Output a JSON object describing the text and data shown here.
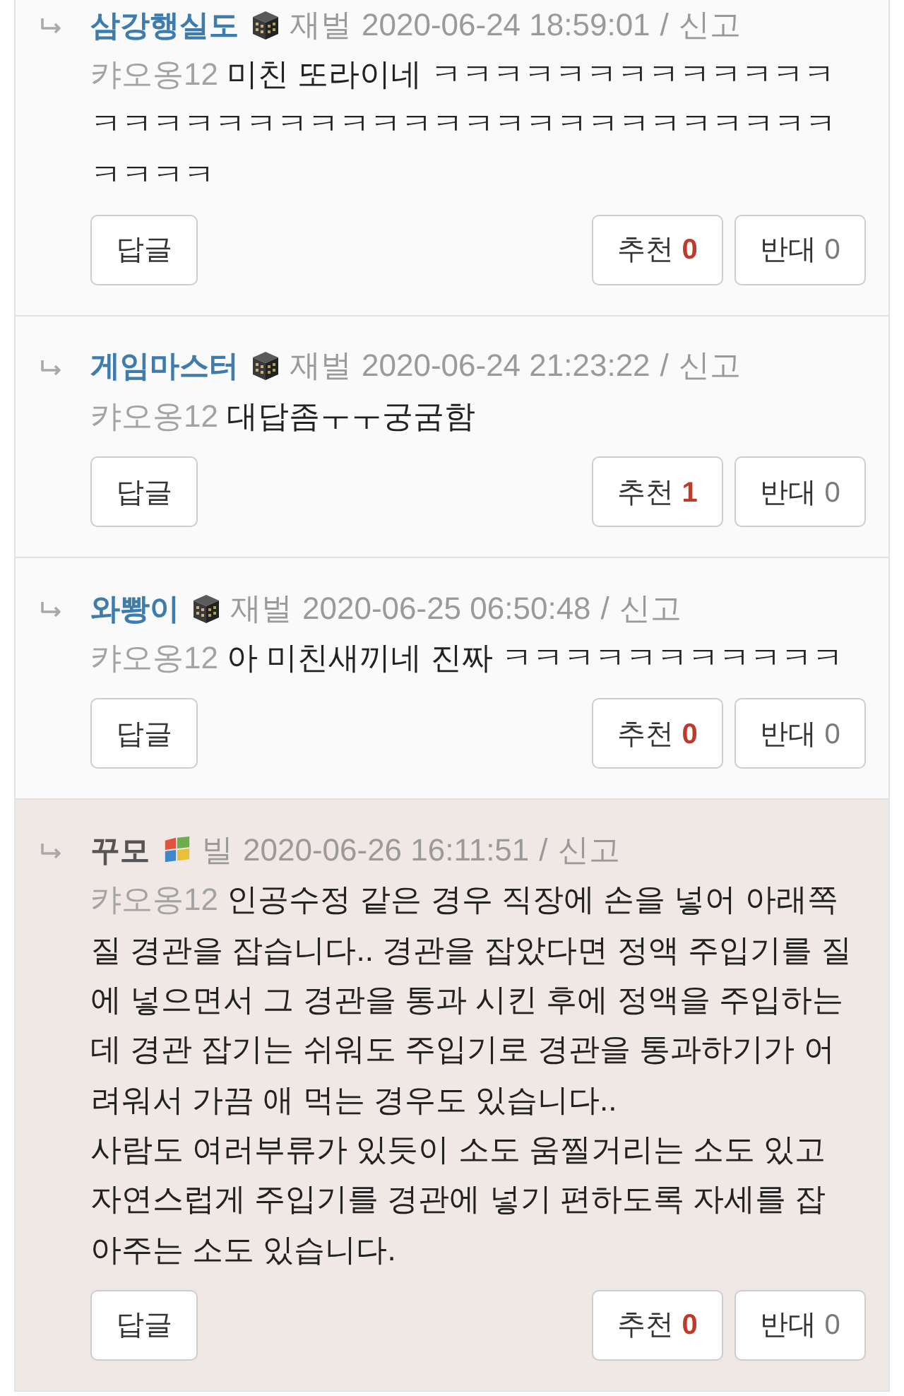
{
  "comments": [
    {
      "highlighted": false,
      "author": "삼강행실도",
      "rank": {
        "kind": "building",
        "label": "재벌"
      },
      "date": "2020-06-24 18:59:01",
      "separator": "/",
      "report": "신고",
      "reply_to": "캬오옹12",
      "text": "미친 또라이네 ㅋㅋㅋㅋㅋㅋㅋㅋㅋㅋㅋㅋㅋㅋㅋㅋㅋㅋㅋㅋㅋㅋㅋㅋㅋㅋㅋㅋㅋㅋㅋㅋㅋㅋㅋㅋㅋㅋㅋㅋㅋ",
      "reply_button": "답글",
      "upvote": {
        "label": "추천",
        "count": "0"
      },
      "downvote": {
        "label": "반대",
        "count": "0"
      }
    },
    {
      "highlighted": false,
      "author": "게임마스터",
      "rank": {
        "kind": "building",
        "label": "재벌"
      },
      "date": "2020-06-24 21:23:22",
      "separator": "/",
      "report": "신고",
      "reply_to": "캬오옹12",
      "text": "대답좀ㅜㅜ궁굼함",
      "reply_button": "답글",
      "upvote": {
        "label": "추천",
        "count": "1"
      },
      "downvote": {
        "label": "반대",
        "count": "0"
      }
    },
    {
      "highlighted": false,
      "author": "와뽱이",
      "rank": {
        "kind": "building",
        "label": "재벌"
      },
      "date": "2020-06-25 06:50:48",
      "separator": "/",
      "report": "신고",
      "reply_to": "캬오옹12",
      "text": "아 미친새끼네 진짜 ㅋㅋㅋㅋㅋㅋㅋㅋㅋㅋㅋ",
      "reply_button": "답글",
      "upvote": {
        "label": "추천",
        "count": "0"
      },
      "downvote": {
        "label": "반대",
        "count": "0"
      }
    },
    {
      "highlighted": true,
      "author": "꾸모",
      "rank": {
        "kind": "flag",
        "label": "빌"
      },
      "date": "2020-06-26 16:11:51",
      "separator": "/",
      "report": "신고",
      "reply_to": "캬오옹12",
      "text": "인공수정 같은 경우 직장에 손을 넣어 아래쪽 질 경관을 잡습니다.. 경관을 잡았다면 정액 주입기를 질에 넣으면서 그 경관을 통과 시킨 후에 정액을 주입하는데 경관 잡기는 쉬워도 주입기로 경관을 통과하기가 어려워서 가끔 애 먹는 경우도 있습니다..\n사람도 여러부류가 있듯이 소도 움찔거리는 소도 있고 자연스럽게 주입기를 경관에 넣기 편하도록 자세를 잡아주는 소도 있습니다.",
      "reply_button": "답글",
      "upvote": {
        "label": "추천",
        "count": "0"
      },
      "downvote": {
        "label": "반대",
        "count": "0"
      }
    }
  ]
}
